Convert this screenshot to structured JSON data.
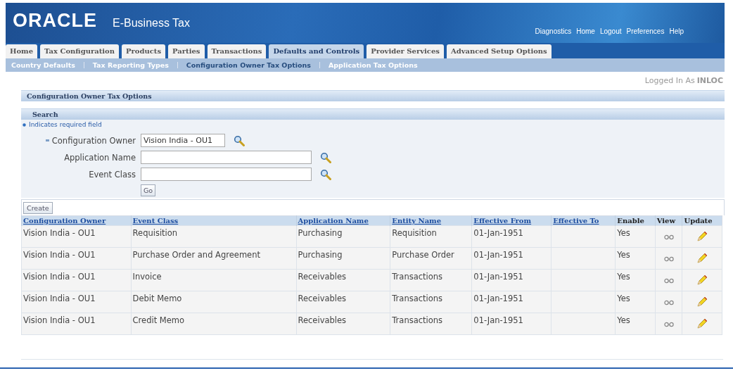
{
  "header": {
    "logo": "ORACLE",
    "product": "E-Business Tax",
    "global_links": [
      "Diagnostics",
      "Home",
      "Logout",
      "Preferences",
      "Help"
    ]
  },
  "tabs": [
    {
      "label": "Home",
      "selected": false
    },
    {
      "label": "Tax Configuration",
      "selected": false
    },
    {
      "label": "Products",
      "selected": false
    },
    {
      "label": "Parties",
      "selected": false
    },
    {
      "label": "Transactions",
      "selected": false
    },
    {
      "label": "Defaults and Controls",
      "selected": true
    },
    {
      "label": "Provider Services",
      "selected": false
    },
    {
      "label": "Advanced Setup Options",
      "selected": false
    }
  ],
  "subtabs": [
    {
      "label": "Country Defaults",
      "selected": false
    },
    {
      "label": "Tax Reporting Types",
      "selected": false
    },
    {
      "label": "Configuration Owner Tax Options",
      "selected": true
    },
    {
      "label": "Application Tax Options",
      "selected": false
    }
  ],
  "logged_in": {
    "label": "Logged In As",
    "user": "INLOC"
  },
  "page_title": "Configuration Owner Tax Options",
  "search": {
    "title": "Search",
    "required_note": "Indicates required field",
    "fields": [
      {
        "label": "Configuration Owner",
        "required": true,
        "value": "Vision India - OU1"
      },
      {
        "label": "Application Name",
        "required": false
      },
      {
        "label": "Event Class",
        "required": false
      }
    ],
    "go_button": "Go"
  },
  "create_button": "Create",
  "table": {
    "columns": [
      {
        "label": "Configuration Owner",
        "sortable": true
      },
      {
        "label": "Event Class",
        "sortable": true
      },
      {
        "label": "Application Name",
        "sortable": true
      },
      {
        "label": "Entity Name",
        "sortable": true
      },
      {
        "label": "Effective From",
        "sortable": true
      },
      {
        "label": "Effective To",
        "sortable": true
      },
      {
        "label": "Enable",
        "sortable": false
      },
      {
        "label": "View",
        "sortable": false
      },
      {
        "label": "Update",
        "sortable": false
      }
    ],
    "rows": [
      {
        "owner": "Vision India - OU1",
        "event_class": "Requisition",
        "application": "Purchasing",
        "entity": "Requisition",
        "effective_from": "01-Jan-1951",
        "enable": "Yes"
      },
      {
        "owner": "Vision India - OU1",
        "event_class": "Purchase Order and Agreement",
        "application": "Purchasing",
        "entity": "Purchase Order",
        "effective_from": "01-Jan-1951",
        "enable": "Yes"
      },
      {
        "owner": "Vision India - OU1",
        "event_class": "Invoice",
        "application": "Receivables",
        "entity": "Transactions",
        "effective_from": "01-Jan-1951",
        "enable": "Yes"
      },
      {
        "owner": "Vision India - OU1",
        "event_class": "Debit Memo",
        "application": "Receivables",
        "entity": "Transactions",
        "effective_from": "01-Jan-1951",
        "enable": "Yes"
      },
      {
        "owner": "Vision India - OU1",
        "event_class": "Credit Memo",
        "application": "Receivables",
        "entity": "Transactions",
        "effective_from": "01-Jan-1951",
        "enable": "Yes"
      }
    ]
  }
}
